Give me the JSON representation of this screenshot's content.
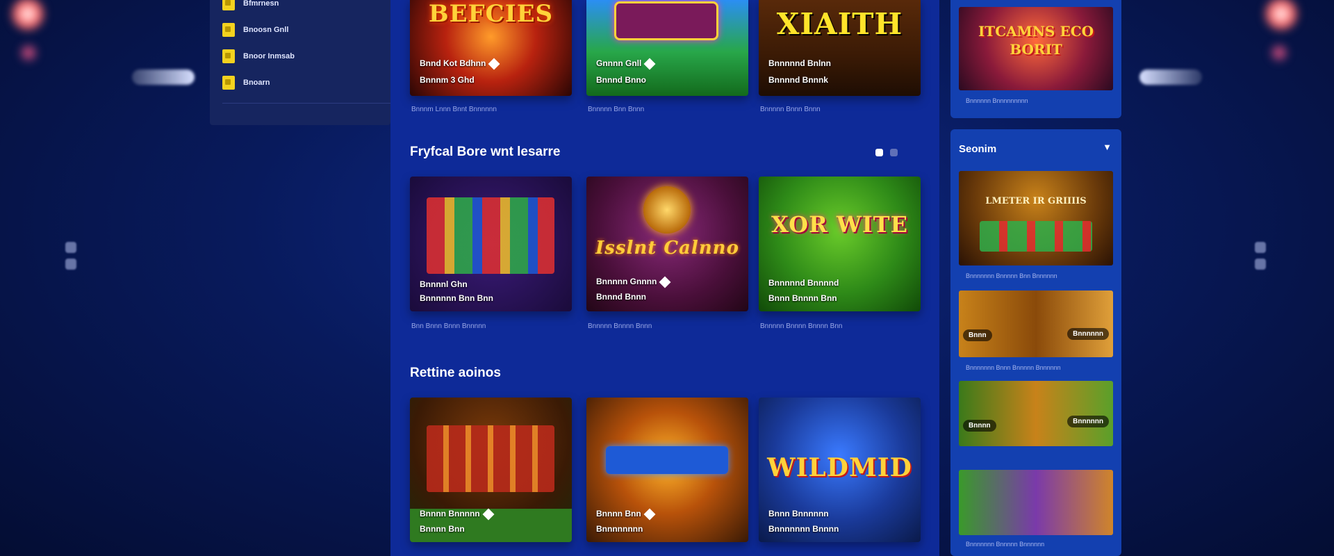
{
  "theme": {
    "accent": "#f3d21f",
    "panel_bg": "#0e2a98",
    "sidebar_bg": "#16255f",
    "right_panel_bg": "#1340b0"
  },
  "left_menu": {
    "items": [
      {
        "label": "Bfmrnesn",
        "icon": "folder-icon"
      },
      {
        "label": "Bnoosn Gnll",
        "icon": "folder-icon"
      },
      {
        "label": "Bnoor Inmsab",
        "icon": "folder-icon"
      },
      {
        "label": "Bnoarn",
        "icon": "folder-icon"
      }
    ]
  },
  "top_row": {
    "cards": [
      {
        "logo": "BEFCIES",
        "line1": "Bnnd Kot Bdhnn",
        "line2": "Bnnnm 3 Ghd",
        "caption": "Bnnnm Lnnn Bnnt Bnnnnnn"
      },
      {
        "logo": "",
        "line1": "Gnnnn Gnll",
        "line2": "Bnnnd Bnno",
        "caption": "Bnnnnn Bnn Bnnn"
      },
      {
        "logo": "XIAITH",
        "line1": "Bnnnnnd Bnlnn",
        "line2": "Bnnnnd Bnnnk",
        "caption": "Bnnnnn Bnnn Bnnn"
      }
    ]
  },
  "section_featured": {
    "title": "Fryfcal Bore wnt lesarre",
    "cards": [
      {
        "logo": "",
        "line1": "Bnnnnl Ghn",
        "line2": "Bnnnnnn Bnn Bnn",
        "caption": "Bnn Bnnn Bnnn Bnnnnn"
      },
      {
        "logo": "Isslnt Calnno",
        "line1": "Bnnnnn Gnnnn",
        "line2": "Bnnnd Bnnn",
        "caption": "Bnnnnn Bnnnn Bnnn"
      },
      {
        "logo": "XOR WITE",
        "line1": "Bnnnnnd Bnnnnd",
        "line2": "Bnnn Bnnnn Bnn",
        "caption": "Bnnnnn Bnnnn Bnnnn Bnn"
      }
    ]
  },
  "section_retro": {
    "title": "Rettine aoinos",
    "cards": [
      {
        "logo": "",
        "line1": "Bnnnn Bnnnnn",
        "line2": "Bnnnn Bnn",
        "caption": ""
      },
      {
        "logo": "",
        "line1": "Bnnnn Bnn",
        "line2": "Bnnnnnnnn",
        "caption": ""
      },
      {
        "logo": "WILDMID",
        "line1": "Bnnn Bnnnnnn",
        "line2": "Bnnnnnnn Bnnnn",
        "caption": ""
      }
    ]
  },
  "right_panel": {
    "promo": {
      "logo": "ITCAMNS ECO BORIT",
      "caption": "Bnnnnnn Bnnnnnnnnn"
    },
    "list_title": "Seonim",
    "chevron": "chevron-down-icon",
    "items": [
      {
        "logo": "LMETER IR GRIIIIS",
        "caption": "Bnnnnnnn Bnnnnn Bnn Bnnnnnn",
        "badge_left": "",
        "badge_right": ""
      },
      {
        "logo": "",
        "caption": "Bnnnnnnn Bnnn Bnnnnn Bnnnnnn",
        "badge_left": "Bnnn",
        "badge_right": "Bnnnnnn"
      },
      {
        "logo": "",
        "caption": "",
        "badge_left": "Bnnnn",
        "badge_right": "Bnnnnnn"
      },
      {
        "logo": "",
        "caption": "Bnnnnnnn Bnnnnn Bnnnnnn",
        "badge_left": "",
        "badge_right": ""
      }
    ]
  }
}
